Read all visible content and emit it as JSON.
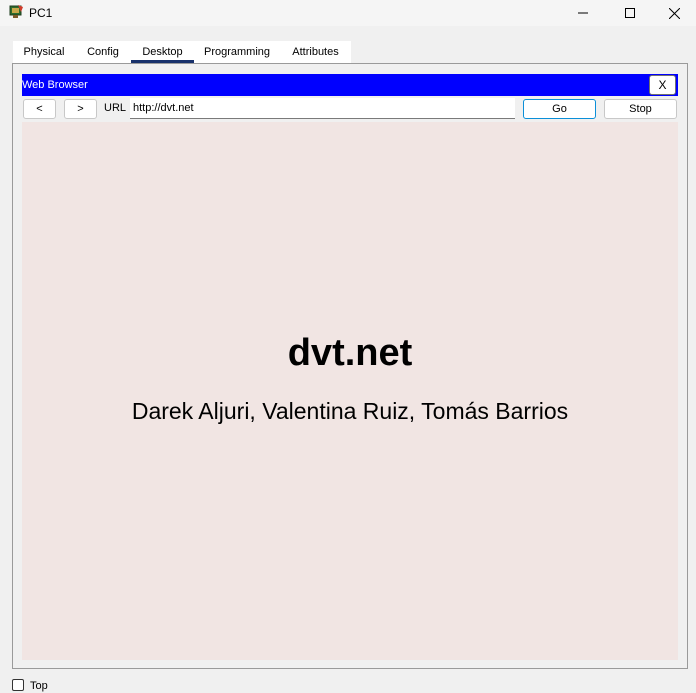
{
  "window": {
    "title": "PC1",
    "icon": "packet-tracer-pc-icon",
    "controls": [
      "minimize-icon",
      "maximize-icon",
      "close-icon"
    ]
  },
  "tabs": [
    "Physical",
    "Config",
    "Desktop",
    "Programming",
    "Attributes"
  ],
  "active_tab": "Desktop",
  "browser": {
    "title": "Web Browser",
    "close_label": "X",
    "back_label": "<",
    "forward_label": ">",
    "url_label": "URL",
    "url_value": "http://dvt.net",
    "go_label": "Go",
    "stop_label": "Stop",
    "titlebar_color": "#0000ff",
    "content_background": "#f1e5e3"
  },
  "page": {
    "heading": "dvt.net",
    "names": "Darek Aljuri, Valentina Ruiz, Tomás Barrios"
  },
  "footer": {
    "top_label": "Top",
    "top_checked": false
  }
}
